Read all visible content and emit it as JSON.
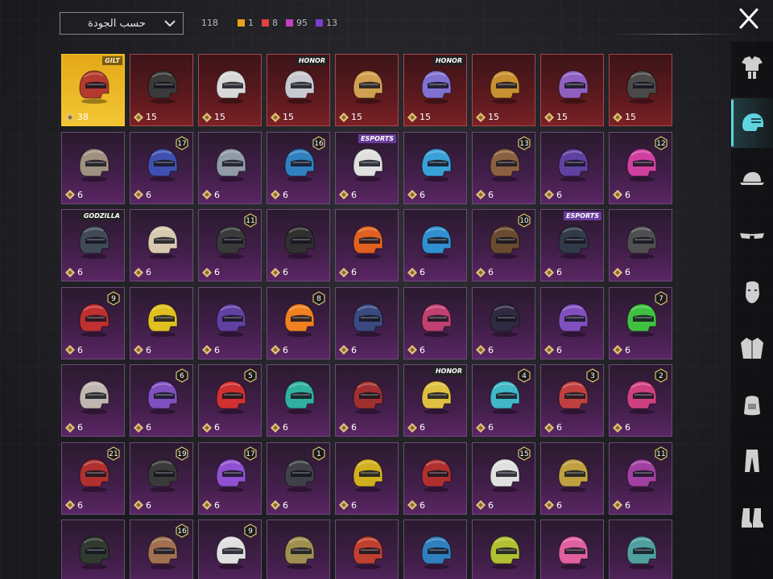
{
  "header": {
    "sort_label": "حسب الجودة",
    "total": "118",
    "counts": [
      {
        "value": "1",
        "color": "#e8a21c"
      },
      {
        "value": "8",
        "color": "#e04040"
      },
      {
        "value": "95",
        "color": "#c53ec3"
      },
      {
        "value": "13",
        "color": "#7a3fd1"
      }
    ]
  },
  "sidebar": {
    "categories": [
      {
        "name": "outfit-icon",
        "active": false
      },
      {
        "name": "helmet-icon",
        "active": true
      },
      {
        "name": "hat-icon",
        "active": false
      },
      {
        "name": "glasses-icon",
        "active": false
      },
      {
        "name": "mask-icon",
        "active": false
      },
      {
        "name": "jacket-icon",
        "active": false
      },
      {
        "name": "backpack-icon",
        "active": false
      },
      {
        "name": "pants-icon",
        "active": false
      },
      {
        "name": "shoes-icon",
        "active": false
      }
    ]
  },
  "items": [
    {
      "price": "38",
      "rarity": "gold",
      "tag": "GILT",
      "tagstyle": "gilt",
      "color": "#b43a30"
    },
    {
      "price": "15",
      "rarity": "red",
      "color": "#3a3a3a"
    },
    {
      "price": "15",
      "rarity": "red",
      "color": "#d8d8d8"
    },
    {
      "price": "15",
      "rarity": "red",
      "tag": "HONOR",
      "tagstyle": "dark",
      "color": "#c8c8d0"
    },
    {
      "price": "15",
      "rarity": "red",
      "color": "#d0a050"
    },
    {
      "price": "15",
      "rarity": "red",
      "tag": "HONOR",
      "tagstyle": "dark",
      "color": "#8070d0"
    },
    {
      "price": "15",
      "rarity": "red",
      "color": "#c89030"
    },
    {
      "price": "15",
      "rarity": "red",
      "color": "#9060c0"
    },
    {
      "price": "15",
      "rarity": "red",
      "color": "#4a4a4a"
    },
    {
      "price": "6",
      "rarity": "purple",
      "color": "#a09080"
    },
    {
      "price": "6",
      "rarity": "purple",
      "level": "17",
      "color": "#4050b0"
    },
    {
      "price": "6",
      "rarity": "purple",
      "color": "#909aa8"
    },
    {
      "price": "6",
      "rarity": "purple",
      "level": "16",
      "color": "#3080c0"
    },
    {
      "price": "6",
      "rarity": "purple",
      "tag": "ESPORTS",
      "tagstyle": "",
      "color": "#e0e0e0"
    },
    {
      "price": "6",
      "rarity": "purple",
      "color": "#3aa0d8"
    },
    {
      "price": "6",
      "rarity": "purple",
      "level": "13",
      "color": "#8a6040"
    },
    {
      "price": "6",
      "rarity": "purple",
      "color": "#6040a0"
    },
    {
      "price": "6",
      "rarity": "purple",
      "level": "12",
      "color": "#d040a0"
    },
    {
      "price": "6",
      "rarity": "purple",
      "tag": "GODZILLA",
      "tagstyle": "dark",
      "color": "#404a58"
    },
    {
      "price": "6",
      "rarity": "purple",
      "color": "#d8cab0"
    },
    {
      "price": "6",
      "rarity": "purple",
      "level": "11",
      "color": "#3a3a3a"
    },
    {
      "price": "6",
      "rarity": "purple",
      "color": "#303030"
    },
    {
      "price": "6",
      "rarity": "purple",
      "color": "#e06020"
    },
    {
      "price": "6",
      "rarity": "purple",
      "color": "#3090d0"
    },
    {
      "price": "6",
      "rarity": "purple",
      "level": "10",
      "color": "#6a4a30"
    },
    {
      "price": "6",
      "rarity": "purple",
      "tag": "ESPORTS",
      "tagstyle": "",
      "color": "#303a48"
    },
    {
      "price": "6",
      "rarity": "purple",
      "color": "#505050"
    },
    {
      "price": "6",
      "rarity": "purple",
      "level": "9",
      "color": "#c03030"
    },
    {
      "price": "6",
      "rarity": "purple",
      "color": "#e0c020"
    },
    {
      "price": "6",
      "rarity": "purple",
      "color": "#6040a0"
    },
    {
      "price": "6",
      "rarity": "purple",
      "level": "8",
      "color": "#f08020"
    },
    {
      "price": "6",
      "rarity": "purple",
      "color": "#3a4a80"
    },
    {
      "price": "6",
      "rarity": "purple",
      "color": "#c04070"
    },
    {
      "price": "6",
      "rarity": "purple",
      "color": "#302a40"
    },
    {
      "price": "6",
      "rarity": "purple",
      "color": "#8050c0"
    },
    {
      "price": "6",
      "rarity": "purple",
      "level": "7",
      "color": "#40c040"
    },
    {
      "price": "6",
      "rarity": "purple",
      "color": "#c0b8b0"
    },
    {
      "price": "6",
      "rarity": "purple",
      "level": "6",
      "color": "#8050c0"
    },
    {
      "price": "6",
      "rarity": "purple",
      "level": "5",
      "color": "#d03030"
    },
    {
      "price": "6",
      "rarity": "purple",
      "color": "#30b0a0"
    },
    {
      "price": "6",
      "rarity": "purple",
      "color": "#a03030"
    },
    {
      "price": "6",
      "rarity": "purple",
      "tag": "HONOR",
      "tagstyle": "dark",
      "color": "#e0c040"
    },
    {
      "price": "6",
      "rarity": "purple",
      "level": "4",
      "color": "#40b8c8"
    },
    {
      "price": "6",
      "rarity": "purple",
      "level": "3",
      "color": "#c04040"
    },
    {
      "price": "6",
      "rarity": "purple",
      "level": "2",
      "color": "#d04080"
    },
    {
      "price": "6",
      "rarity": "purple",
      "level": "21",
      "color": "#b03030"
    },
    {
      "price": "6",
      "rarity": "purple",
      "level": "19",
      "color": "#3a3a3a"
    },
    {
      "price": "6",
      "rarity": "purple",
      "level": "17",
      "color": "#9050d0"
    },
    {
      "price": "6",
      "rarity": "purple",
      "level": "1",
      "color": "#404048"
    },
    {
      "price": "6",
      "rarity": "purple",
      "color": "#d0b020"
    },
    {
      "price": "6",
      "rarity": "purple",
      "color": "#b03030"
    },
    {
      "price": "6",
      "rarity": "purple",
      "level": "15",
      "color": "#e0e0e0"
    },
    {
      "price": "6",
      "rarity": "purple",
      "color": "#c0a040"
    },
    {
      "price": "6",
      "rarity": "purple",
      "level": "11",
      "color": "#a040a0"
    },
    {
      "price": "",
      "rarity": "purple",
      "color": "#303a30"
    },
    {
      "price": "",
      "rarity": "purple",
      "level": "16",
      "color": "#a07050"
    },
    {
      "price": "",
      "rarity": "purple",
      "level": "9",
      "color": "#e0e0e0"
    },
    {
      "price": "",
      "rarity": "purple",
      "color": "#a09050"
    },
    {
      "price": "",
      "rarity": "purple",
      "color": "#c04030"
    },
    {
      "price": "",
      "rarity": "purple",
      "color": "#3080c0"
    },
    {
      "price": "",
      "rarity": "purple",
      "color": "#b0c030"
    },
    {
      "price": "",
      "rarity": "purple",
      "color": "#e060a0"
    },
    {
      "price": "",
      "rarity": "purple",
      "color": "#50a0a0"
    }
  ]
}
